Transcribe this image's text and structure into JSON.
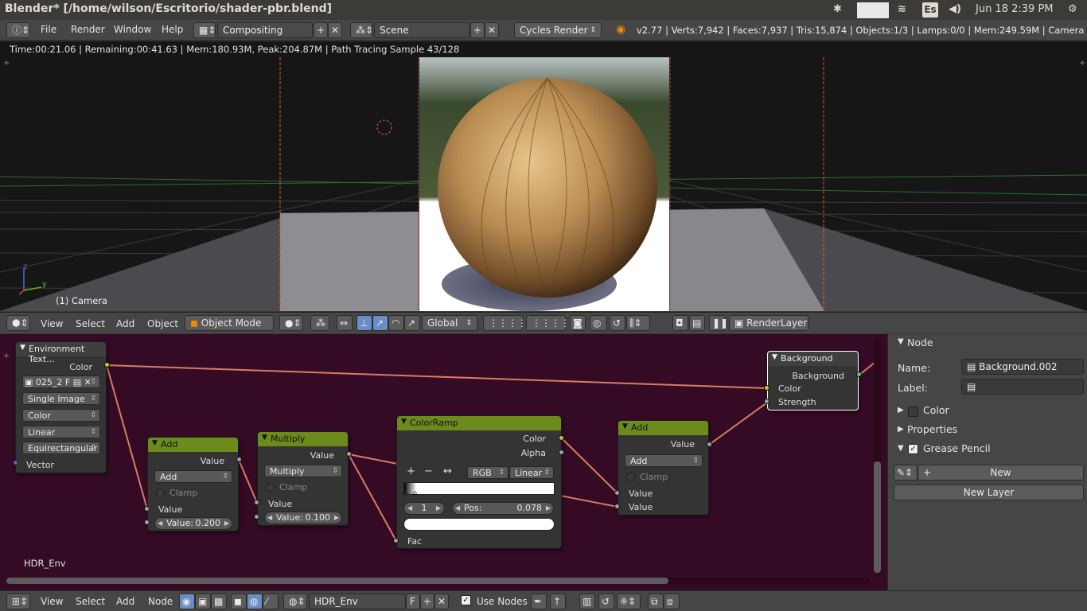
{
  "os": {
    "window_title": "Blender* [/home/wilson/Escritorio/shader-pbr.blend]",
    "keyboard": "Es",
    "clock": "Jun 18  2:39 PM"
  },
  "info_header": {
    "menus": [
      "File",
      "Render",
      "Window",
      "Help"
    ],
    "screen_layout": "Compositing",
    "scene": "Scene",
    "render_engine": "Cycles Render",
    "stats": "v2.77 | Verts:7,942 | Faces:7,937 | Tris:15,874 | Objects:1/3 | Lamps:0/0 | Mem:249.59M | Camera"
  },
  "viewport": {
    "render_info": "Time:00:21.06 | Remaining:00:41.63 | Mem:180.93M, Peak:204.87M | Path Tracing Sample 43/128",
    "object_label": "(1) Camera",
    "axis_z": "z",
    "axis_y": "y"
  },
  "viewport_header": {
    "menus": [
      "View",
      "Select",
      "Add",
      "Object"
    ],
    "mode": "Object Mode",
    "orientation": "Global",
    "render_layer": "RenderLayer"
  },
  "node_editor": {
    "material_label": "HDR_Env",
    "nodes": {
      "env": {
        "title": "Environment Text...",
        "out_color": "Color",
        "image_name": "025_2",
        "image_flag": "F",
        "source": "Single Image",
        "colorspace": "Color",
        "interpolation": "Linear",
        "projection": "Equirectangular",
        "in_vector": "Vector"
      },
      "add1": {
        "title": "Add",
        "out": "Value",
        "op": "Add",
        "clamp": "Clamp",
        "in_value": "Value",
        "value_label": "Value:",
        "value": "0.200"
      },
      "mult": {
        "title": "Multiply",
        "out": "Value",
        "op": "Multiply",
        "clamp": "Clamp",
        "in_value": "Value",
        "value_label": "Value:",
        "value": "0.100"
      },
      "ramp": {
        "title": "ColorRamp",
        "out_color": "Color",
        "out_alpha": "Alpha",
        "mode": "RGB",
        "interp": "Linear",
        "btn_add": "+",
        "btn_remove": "−",
        "btn_flip": "↔",
        "index": "1",
        "pos_label": "Pos:",
        "pos": "0.078",
        "in_fac": "Fac"
      },
      "add2": {
        "title": "Add",
        "out": "Value",
        "op": "Add",
        "clamp": "Clamp",
        "in_value1": "Value",
        "in_value2": "Value"
      },
      "bg": {
        "title": "Background",
        "out": "Background",
        "in_color": "Color",
        "in_strength": "Strength"
      }
    }
  },
  "properties_panel": {
    "section_node": "Node",
    "name_label": "Name:",
    "name_value": "Background.002",
    "label_label": "Label:",
    "label_value": "",
    "section_color": "Color",
    "section_properties": "Properties",
    "section_grease": "Grease Pencil",
    "new_button": "New",
    "new_layer_button": "New Layer"
  },
  "bottom_header": {
    "menus": [
      "View",
      "Select",
      "Add",
      "Node"
    ],
    "material_name": "HDR_Env",
    "fake_user": "F",
    "use_nodes": "Use Nodes"
  },
  "colors": {
    "node_bg": "#350a24",
    "node_header_green": "#6d8a1d",
    "link_color": "#e8865a",
    "viewport_bg": "#161616"
  }
}
